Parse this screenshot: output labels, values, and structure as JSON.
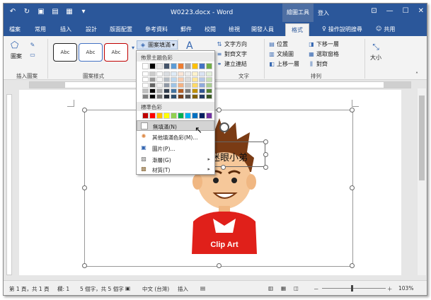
{
  "titlebar": {
    "title": "W0223.docx - Word",
    "context_tools": "繪圖工具",
    "login": "登入"
  },
  "tabs": [
    {
      "label": "檔案"
    },
    {
      "label": "常用"
    },
    {
      "label": "插入"
    },
    {
      "label": "設計"
    },
    {
      "label": "版面配置"
    },
    {
      "label": "參考資料"
    },
    {
      "label": "郵件"
    },
    {
      "label": "校閱"
    },
    {
      "label": "檢視"
    },
    {
      "label": "開發人員"
    },
    {
      "label": "格式"
    }
  ],
  "tellme": "操作說明搜尋",
  "share": "共用",
  "ribbon": {
    "insert_shapes": "插入圖案",
    "shape_styles": "圖案樣式",
    "text_group": "文字",
    "arrange_group": "排列",
    "shape_label": "圖案",
    "abc": "Abc",
    "fill_button": "圖案填滿",
    "text_direction": "文字方向",
    "align_text": "對齊文字",
    "create_link": "建立連結",
    "position": "位置",
    "wrap_text": "文繞圖",
    "bring_forward": "上移一層",
    "send_backward": "下移一層",
    "selection_pane": "選取窗格",
    "align": "對齊",
    "size": "大小"
  },
  "dropdown": {
    "theme_colors": "佈景主題色彩",
    "standard_colors": "標準色彩",
    "no_fill": "無填滿(N)",
    "more_colors": "其他填滿色彩(M)...",
    "picture": "圖片(P)...",
    "gradient": "漸層(G)",
    "texture": "材質(T)"
  },
  "theme_palette": [
    [
      "#ffffff",
      "#000000",
      "#e7e6e6",
      "#44546a",
      "#5b9bd5",
      "#ed7d31",
      "#a5a5a5",
      "#ffc000",
      "#4472c4",
      "#70ad47"
    ]
  ],
  "standard_palette": [
    "#c00000",
    "#ff0000",
    "#ffc000",
    "#ffff00",
    "#92d050",
    "#00b050",
    "#00b0f0",
    "#0070c0",
    "#002060",
    "#7030a0"
  ],
  "document": {
    "wordart": "迷眼小弟",
    "clipart_label": "Clip Art"
  },
  "status": {
    "page": "第 1 頁，共 1 頁",
    "line": "欄: 1",
    "words": "5 個字，共 5 個字",
    "language": "中文 (台灣)",
    "mode": "插入",
    "zoom": "103%",
    "zoom_minus": "－",
    "zoom_plus": "＋"
  }
}
